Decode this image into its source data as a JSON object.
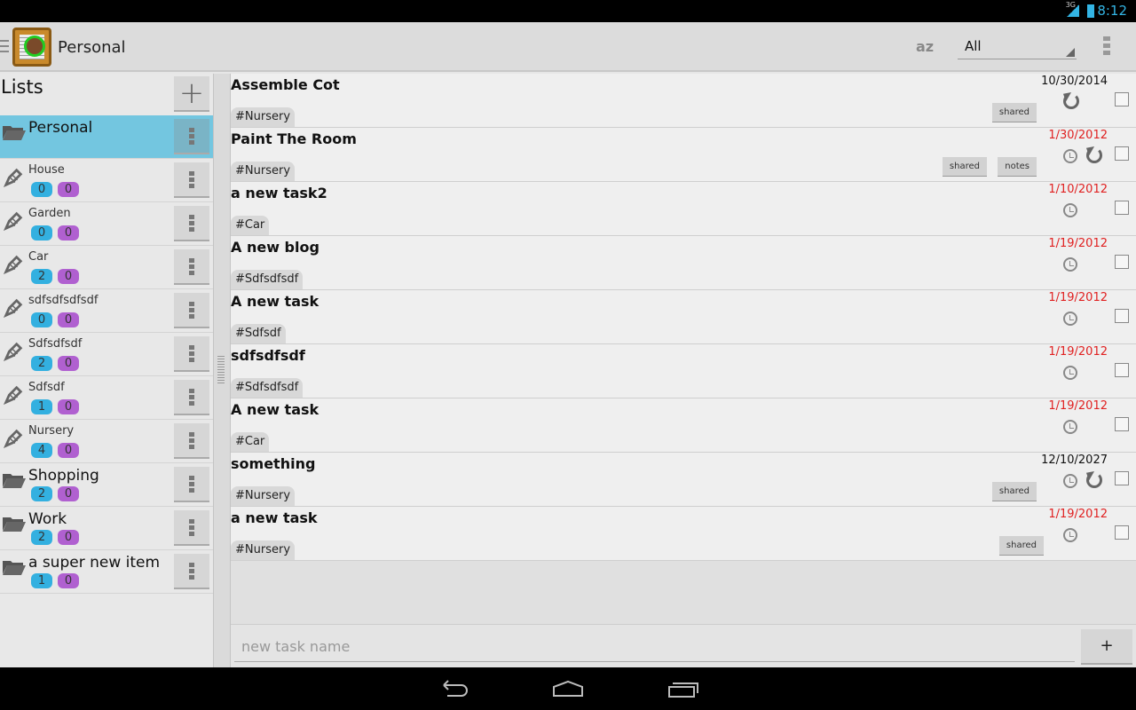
{
  "status": {
    "network": "3G",
    "time": "8:12"
  },
  "actionbar": {
    "title": "Personal",
    "sort_label": "az",
    "filter_value": "All"
  },
  "sidebar": {
    "title": "Lists",
    "items": [
      {
        "name": "Personal",
        "type": "folder",
        "selected": true
      },
      {
        "name": "House",
        "type": "list",
        "count": "0",
        "count2": "0"
      },
      {
        "name": "Garden",
        "type": "list",
        "count": "0",
        "count2": "0"
      },
      {
        "name": "Car",
        "type": "list",
        "count": "2",
        "count2": "0"
      },
      {
        "name": "sdfsdfsdfsdf",
        "type": "list",
        "count": "0",
        "count2": "0"
      },
      {
        "name": "Sdfsdfsdf",
        "type": "list",
        "count": "2",
        "count2": "0"
      },
      {
        "name": "Sdfsdf",
        "type": "list",
        "count": "1",
        "count2": "0"
      },
      {
        "name": "Nursery",
        "type": "list",
        "count": "4",
        "count2": "0"
      },
      {
        "name": "Shopping",
        "type": "folder",
        "count": "2",
        "count2": "0"
      },
      {
        "name": "Work",
        "type": "folder",
        "count": "2",
        "count2": "0"
      },
      {
        "name": "a super new item",
        "type": "folder",
        "count": "1",
        "count2": "0"
      }
    ]
  },
  "tasks": [
    {
      "name": "Assemble Cot",
      "tag": "#Nursery",
      "date": "10/30/2014",
      "overdue": false,
      "alarm": false,
      "repeat": true,
      "pills": [
        "shared"
      ]
    },
    {
      "name": "Paint The Room",
      "tag": "#Nursery",
      "date": "1/30/2012",
      "overdue": true,
      "alarm": true,
      "repeat": true,
      "pills": [
        "shared",
        "notes"
      ]
    },
    {
      "name": "a new task2",
      "tag": "#Car",
      "date": "1/10/2012",
      "overdue": true,
      "alarm": true,
      "repeat": false,
      "pills": []
    },
    {
      "name": "A new blog",
      "tag": "#Sdfsdfsdf",
      "date": "1/19/2012",
      "overdue": true,
      "alarm": true,
      "repeat": false,
      "pills": []
    },
    {
      "name": "A new task",
      "tag": "#Sdfsdf",
      "date": "1/19/2012",
      "overdue": true,
      "alarm": true,
      "repeat": false,
      "pills": []
    },
    {
      "name": "sdfsdfsdf",
      "tag": "#Sdfsdfsdf",
      "date": "1/19/2012",
      "overdue": true,
      "alarm": true,
      "repeat": false,
      "pills": []
    },
    {
      "name": "A new task",
      "tag": "#Car",
      "date": "1/19/2012",
      "overdue": true,
      "alarm": true,
      "repeat": false,
      "pills": []
    },
    {
      "name": "something",
      "tag": "#Nursery",
      "date": "12/10/2027",
      "overdue": false,
      "alarm": true,
      "repeat": true,
      "pills": [
        "shared"
      ]
    },
    {
      "name": "a new task",
      "tag": "#Nursery",
      "date": "1/19/2012",
      "overdue": true,
      "alarm": true,
      "repeat": false,
      "pills": [
        "shared"
      ]
    }
  ],
  "input": {
    "placeholder": "new task name",
    "add_label": "+"
  },
  "colors": {
    "selected": "#73c6e0",
    "count_blue": "#33b0e0",
    "count_purple": "#b060d0",
    "overdue": "#e02020"
  }
}
